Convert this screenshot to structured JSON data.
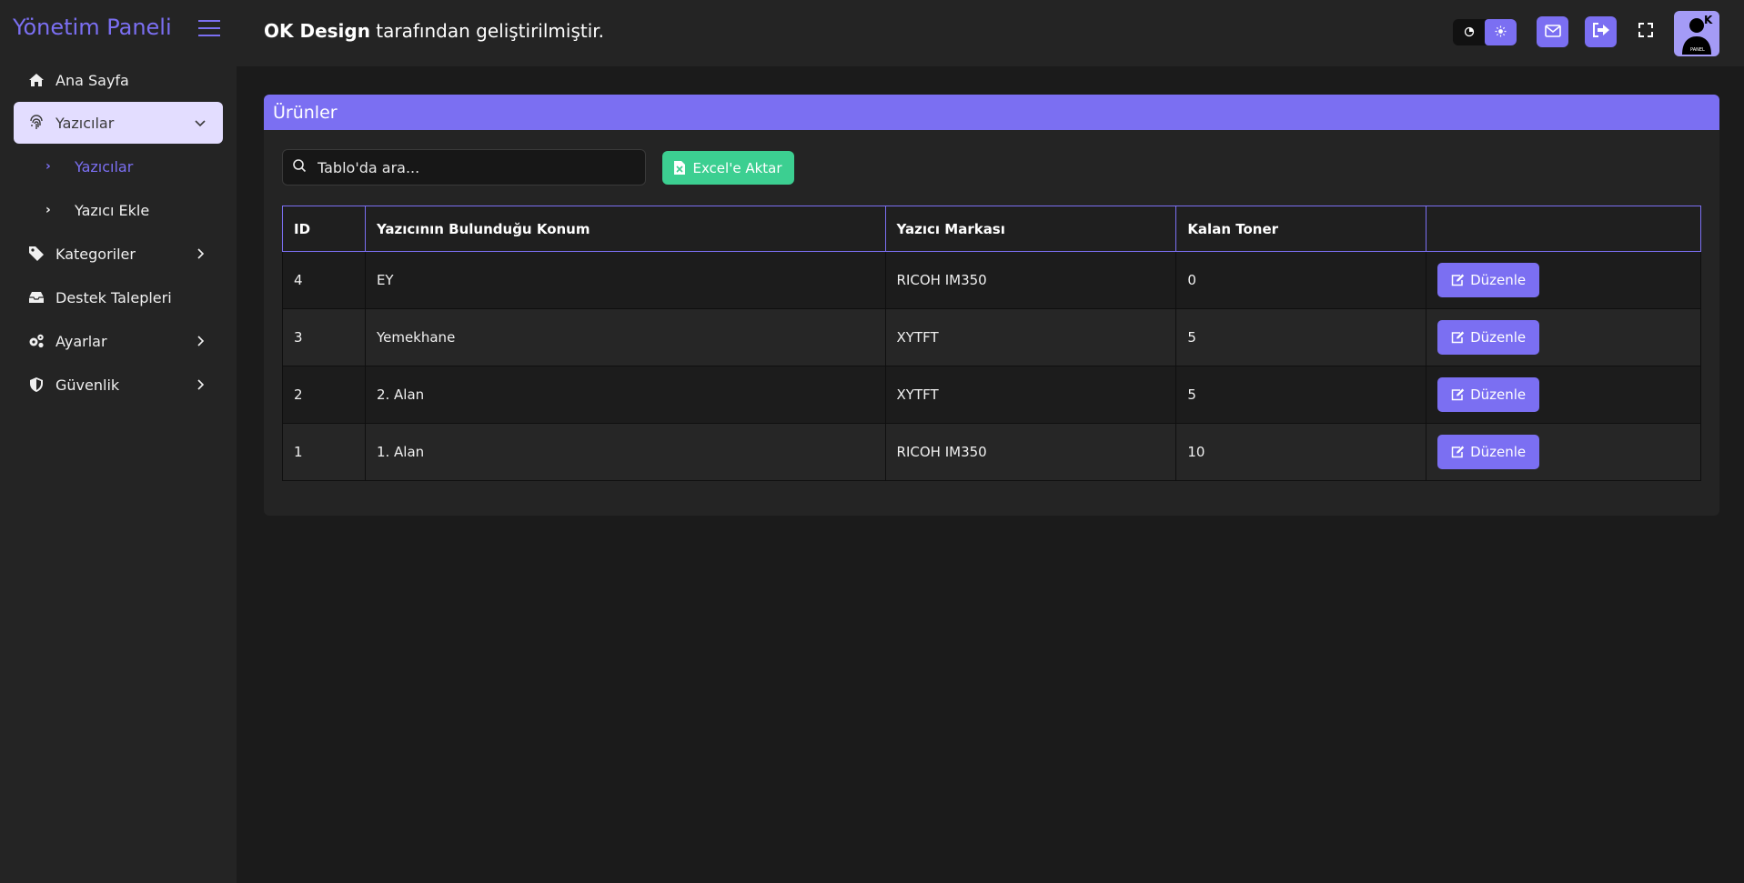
{
  "sidebar": {
    "brand": "Yönetim Paneli",
    "items": [
      {
        "label": "Ana Sayfa",
        "icon": "home-icon"
      },
      {
        "label": "Yazıcılar",
        "icon": "fingerprint-icon",
        "expanded": true
      },
      {
        "label": "Kategoriler",
        "icon": "tag-icon"
      },
      {
        "label": "Destek Talepleri",
        "icon": "inbox-icon"
      },
      {
        "label": "Ayarlar",
        "icon": "gears-icon"
      },
      {
        "label": "Güvenlik",
        "icon": "shield-icon"
      }
    ],
    "subitems": [
      {
        "label": "Yazıcılar",
        "active": true
      },
      {
        "label": "Yazıcı Ekle",
        "active": false
      }
    ]
  },
  "header": {
    "brand_bold": "OK Design",
    "brand_rest": " tarafından geliştirilmiştir.",
    "avatar_text": "PANEL"
  },
  "card": {
    "title": "Ürünler",
    "search_placeholder": "Tablo'da ara...",
    "excel_label": "Excel'e Aktar"
  },
  "table": {
    "headers": [
      "ID",
      "Yazıcının Bulunduğu Konum",
      "Yazıcı Markası",
      "Kalan Toner",
      ""
    ],
    "edit_label": "Düzenle",
    "rows": [
      {
        "id": "4",
        "location": "EY",
        "brand": "RICOH IM350",
        "toner": "0"
      },
      {
        "id": "3",
        "location": "Yemekhane",
        "brand": "XYTFT",
        "toner": "5"
      },
      {
        "id": "2",
        "location": "2. Alan",
        "brand": "XYTFT",
        "toner": "5"
      },
      {
        "id": "1",
        "location": "1. Alan",
        "brand": "RICOH IM350",
        "toner": "10"
      }
    ]
  },
  "colors": {
    "accent": "#7b6ff2",
    "success": "#3ccf91",
    "bg": "#1b1b1b",
    "panel": "#242424"
  }
}
